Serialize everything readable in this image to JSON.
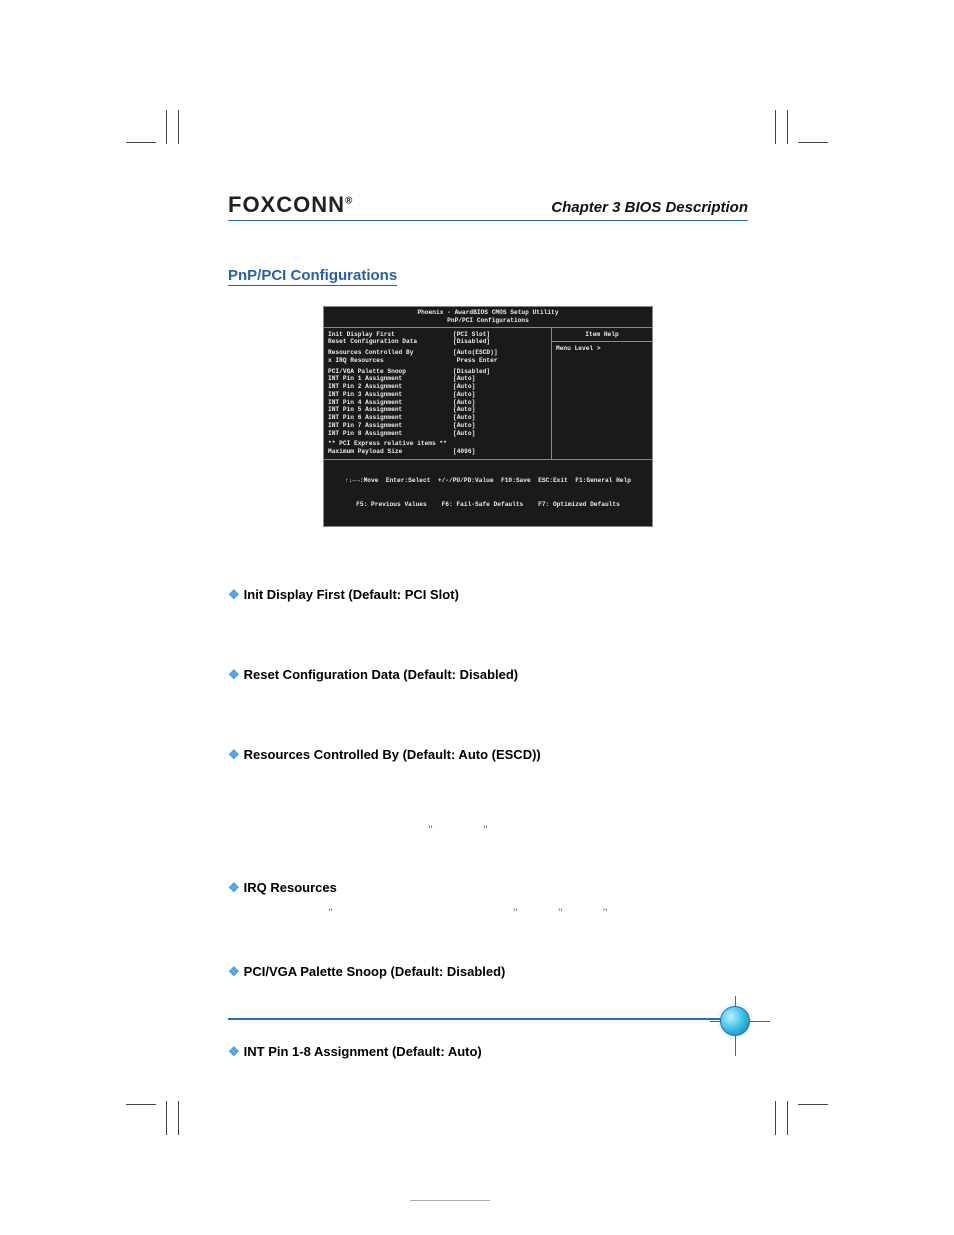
{
  "header": {
    "brand": "FOXCONN",
    "brand_mark": "®",
    "chapter": "Chapter 3    BIOS Description"
  },
  "section_title": "PnP/PCI Configurations",
  "bios": {
    "title1": "Phoenix - AwardBIOS CMOS Setup Utility",
    "title2": "PnP/PCI Configurations",
    "help_title": "Item Help",
    "menu_level": "Menu Level   >",
    "rows": [
      {
        "label": "Init Display First",
        "val": "[PCI Slot]"
      },
      {
        "label": "Reset Configuration Data",
        "val": "[Disabled]"
      }
    ],
    "rows2": [
      {
        "label": "Resources Controlled By",
        "val": "[Auto(ESCD)]"
      },
      {
        "label": "x IRQ Resources",
        "val": " Press Enter"
      }
    ],
    "rows3": [
      {
        "label": "PCI/VGA Palette Snoop",
        "val": "[Disabled]"
      },
      {
        "label": "INT Pin 1 Assignment",
        "val": "[Auto]"
      },
      {
        "label": "INT Pin 2 Assignment",
        "val": "[Auto]"
      },
      {
        "label": "INT Pin 3 Assignment",
        "val": "[Auto]"
      },
      {
        "label": "INT Pin 4 Assignment",
        "val": "[Auto]"
      },
      {
        "label": "INT Pin 5 Assignment",
        "val": "[Auto]"
      },
      {
        "label": "INT Pin 6 Assignment",
        "val": "[Auto]"
      },
      {
        "label": "INT Pin 7 Assignment",
        "val": "[Auto]"
      },
      {
        "label": "INT Pin 8 Assignment",
        "val": "[Auto]"
      }
    ],
    "express_header": "** PCI Express relative items **",
    "rows4": [
      {
        "label": "Maximum Payload Size",
        "val": "[4096]"
      }
    ],
    "footer1": "↑↓←→:Move  Enter:Select  +/-/PU/PD:Value  F10:Save  ESC:Exit  F1:General Help",
    "footer2": "F5: Previous Values    F6: Fail-Safe Defaults    F7: Optimized Defaults"
  },
  "items": [
    {
      "title": "Init  Display First (Default: PCI Slot)",
      "body": ""
    },
    {
      "title": "Reset Configuration Data (Default: Disabled)",
      "body": ""
    },
    {
      "title": "Resources Controlled By (Default: Auto (ESCD))",
      "body": "",
      "extra": {
        "q1": "\"",
        "q2": "\""
      }
    },
    {
      "title": "IRQ Resources",
      "body": "",
      "extra2": {
        "q1": "\"",
        "q2": "\"",
        "q3": "\"",
        "q4": "\""
      }
    },
    {
      "title": "PCI/VGA Palette Snoop (Default: Disabled)",
      "body": ""
    },
    {
      "title": "INT Pin 1-8 Assignment (Default: Auto)",
      "body": ""
    }
  ],
  "bullet_glyph": "❖"
}
